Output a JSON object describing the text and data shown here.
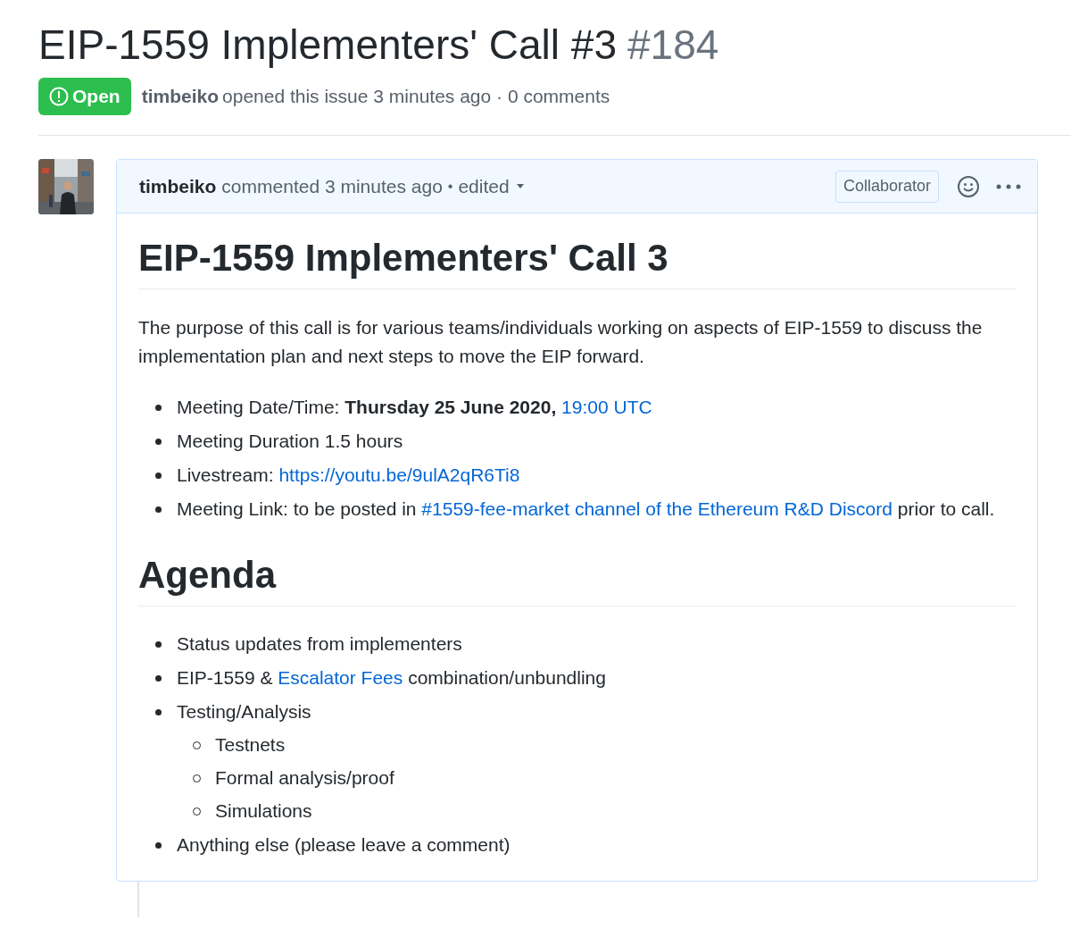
{
  "issue": {
    "title": "EIP-1559 Implementers' Call #3",
    "number": "#184",
    "state": {
      "label": "Open",
      "kind": "open"
    },
    "author": "timbeiko",
    "meta": "opened this issue 3 minutes ago · 0 comments"
  },
  "comment": {
    "author": "timbeiko",
    "action": "commented 3 minutes ago",
    "separator": "•",
    "edited": "edited",
    "role": "Collaborator",
    "heading": "EIP-1559 Implementers' Call 3",
    "intro": "The purpose of this call is for various teams/individuals working on aspects of EIP-1559 to discuss the implementation plan and next steps to move the EIP forward.",
    "details": [
      [
        {
          "kind": "text",
          "text": "Meeting Date/Time: "
        },
        {
          "kind": "bold",
          "text": "Thursday 25 June 2020, "
        },
        {
          "kind": "link",
          "text": "19:00 UTC"
        }
      ],
      [
        {
          "kind": "text",
          "text": "Meeting Duration 1.5 hours"
        }
      ],
      [
        {
          "kind": "text",
          "text": "Livestream: "
        },
        {
          "kind": "link",
          "text": "https://youtu.be/9ulA2qR6Ti8"
        }
      ],
      [
        {
          "kind": "text",
          "text": "Meeting Link: to be posted in "
        },
        {
          "kind": "link",
          "text": "#1559-fee-market channel of the Ethereum R&D Discord"
        },
        {
          "kind": "text",
          "text": " prior to call."
        }
      ]
    ],
    "agenda_heading": "Agenda",
    "agenda": [
      {
        "parts": [
          {
            "kind": "text",
            "text": "Status updates from implementers"
          }
        ]
      },
      {
        "parts": [
          {
            "kind": "text",
            "text": "EIP-1559 & "
          },
          {
            "kind": "link",
            "text": "Escalator Fees"
          },
          {
            "kind": "text",
            "text": " combination/unbundling"
          }
        ]
      },
      {
        "parts": [
          {
            "kind": "text",
            "text": "Testing/Analysis"
          }
        ],
        "children": [
          {
            "text": "Testnets"
          },
          {
            "text": "Formal analysis/proof"
          },
          {
            "text": "Simulations"
          }
        ]
      },
      {
        "parts": [
          {
            "kind": "text",
            "text": "Anything else (please leave a comment)"
          }
        ]
      }
    ]
  }
}
